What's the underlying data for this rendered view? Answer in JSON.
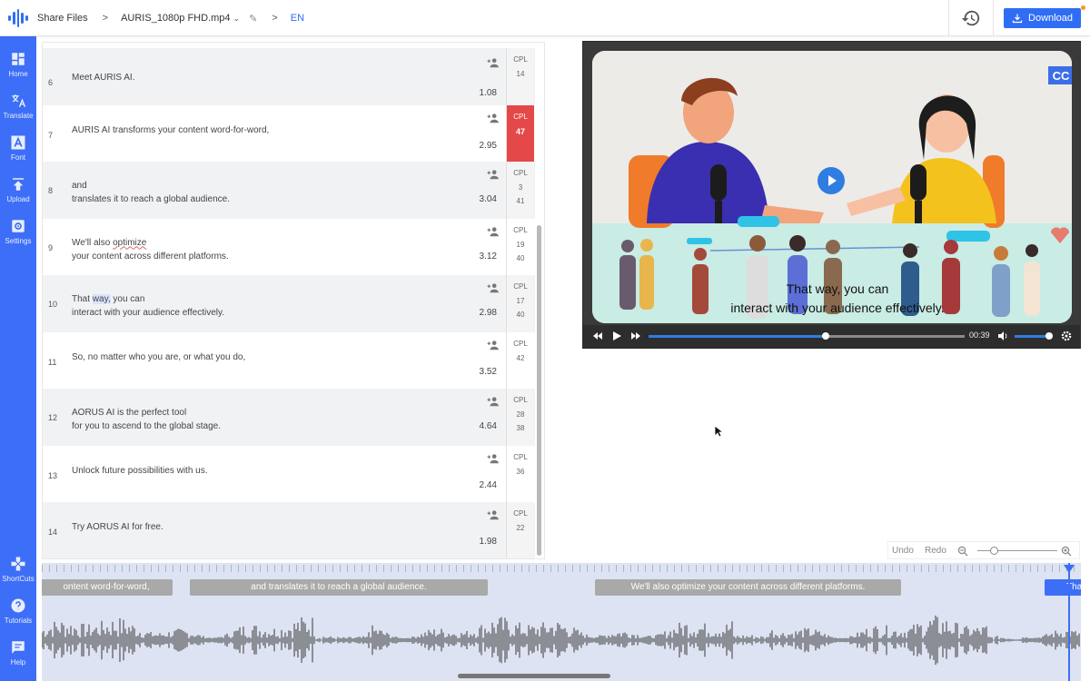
{
  "header": {
    "breadcrumb_root": "Share Files",
    "separator": ">",
    "file_name": "AURIS_1080p FHD.mp4",
    "language": "EN",
    "download_label": "Download"
  },
  "sidebar": {
    "items": [
      {
        "label": "Home",
        "icon": "dashboard-icon"
      },
      {
        "label": "Translate",
        "icon": "translate-icon"
      },
      {
        "label": "Font",
        "icon": "font-icon"
      },
      {
        "label": "Upload",
        "icon": "upload-icon"
      },
      {
        "label": "Settings",
        "icon": "settings-icon"
      }
    ],
    "bottom_items": [
      {
        "label": "ShortCuts",
        "icon": "gamepad-icon"
      },
      {
        "label": "Tutorials",
        "icon": "help-circle-icon"
      },
      {
        "label": "Help",
        "icon": "chat-icon"
      }
    ]
  },
  "subtitles": [
    {
      "num": "6",
      "lines": [
        "Meet AURIS AI."
      ],
      "duration": "1.08",
      "cpl_label": "CPL",
      "cpl": [
        "14"
      ],
      "alert": false
    },
    {
      "num": "7",
      "lines": [
        "AURIS AI transforms your content word-for-word,"
      ],
      "duration": "2.95",
      "cpl_label": "CPL",
      "cpl": [
        "47"
      ],
      "alert": true
    },
    {
      "num": "8",
      "lines": [
        "and",
        "translates it to reach a global audience."
      ],
      "duration": "3.04",
      "cpl_label": "CPL",
      "cpl": [
        "3",
        "41"
      ],
      "alert": false
    },
    {
      "num": "9",
      "lines": [
        "We'll also optimize",
        "your content across different platforms."
      ],
      "duration": "3.12",
      "cpl_label": "CPL",
      "cpl": [
        "19",
        "40"
      ],
      "alert": false
    },
    {
      "num": "10",
      "lines": [
        "That way, you can",
        "interact with your audience effectively."
      ],
      "duration": "2.98",
      "cpl_label": "CPL",
      "cpl": [
        "17",
        "40"
      ],
      "alert": false
    },
    {
      "num": "11",
      "lines": [
        "So, no matter who you are, or what you do,"
      ],
      "duration": "3.52",
      "cpl_label": "CPL",
      "cpl": [
        "42"
      ],
      "alert": false
    },
    {
      "num": "12",
      "lines": [
        "AORUS AI is the perfect tool",
        "for you to ascend to the global stage."
      ],
      "duration": "4.64",
      "cpl_label": "CPL",
      "cpl": [
        "28",
        "38"
      ],
      "alert": false
    },
    {
      "num": "13",
      "lines": [
        "Unlock future possibilities with us."
      ],
      "duration": "2.44",
      "cpl_label": "CPL",
      "cpl": [
        "36"
      ],
      "alert": false
    },
    {
      "num": "14",
      "lines": [
        "Try AORUS AI for free."
      ],
      "duration": "1.98",
      "cpl_label": "CPL",
      "cpl": [
        "22"
      ],
      "alert": false
    }
  ],
  "video": {
    "cc_label": "CC",
    "caption_lines": [
      "That way, you can",
      "interact with your audience effectively."
    ],
    "time": "00:39",
    "progress": 0.56,
    "volume": 0.9
  },
  "editor": {
    "undo_label": "Undo",
    "redo_label": "Redo",
    "zoom_level": 0.2
  },
  "timeline": {
    "segments": [
      {
        "text": "ontent word-for-word,",
        "active": false
      },
      {
        "text": "and translates it to reach a global audience.",
        "active": false
      },
      {
        "text": "We'll also optimize your content across different platforms.",
        "active": false
      },
      {
        "text": "Tha",
        "active": true
      }
    ]
  },
  "colors": {
    "accent": "#3d6ef7",
    "cpl_alert": "#e54848"
  }
}
